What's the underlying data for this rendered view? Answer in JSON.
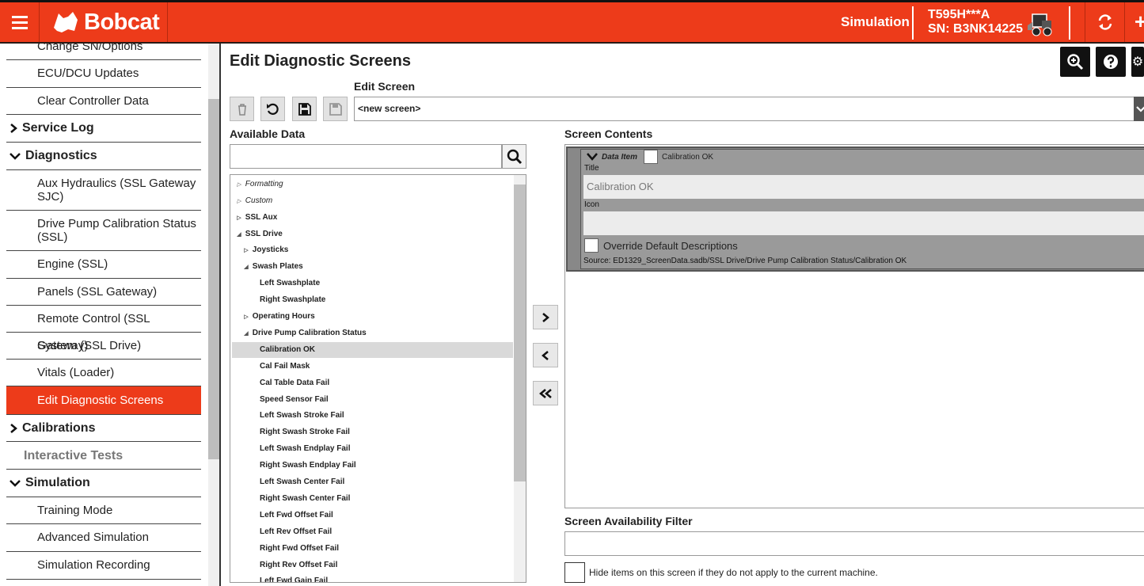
{
  "header": {
    "brand": "Bobcat",
    "mode_label": "Simulation",
    "model": "T595H***A",
    "serial": "SN: B3NK14225",
    "accent_color": "#ed3b1a"
  },
  "sidebar": {
    "items": [
      {
        "label": "Change SN/Options"
      },
      {
        "label": "ECU/DCU Updates"
      },
      {
        "label": "Clear Controller Data"
      },
      {
        "label": "Service Log"
      },
      {
        "label": "Diagnostics"
      },
      {
        "label": "Aux Hydraulics (SSL Gateway SJC)"
      },
      {
        "label": "Drive Pump Calibration Status (SSL)"
      },
      {
        "label": "Engine (SSL)"
      },
      {
        "label": "Panels (SSL Gateway)"
      },
      {
        "label": "Remote Control (SSL Gateway)"
      },
      {
        "label": "System (SSL Drive)"
      },
      {
        "label": "Vitals (Loader)"
      },
      {
        "label": "Edit Diagnostic Screens"
      },
      {
        "label": "Calibrations"
      },
      {
        "label": "Interactive Tests"
      },
      {
        "label": "Simulation"
      },
      {
        "label": "Training Mode"
      },
      {
        "label": "Advanced Simulation"
      },
      {
        "label": "Simulation Recording"
      }
    ]
  },
  "main": {
    "title": "Edit Diagnostic Screens",
    "edit_screen_label": "Edit Screen",
    "edit_screen_value": "<new screen>",
    "available_data_label": "Available Data",
    "screen_contents_label": "Screen Contents",
    "screen_filter_label": "Screen Availability Filter",
    "hide_items_text": "Hide items on this screen if they do not apply to the current machine."
  },
  "tree": [
    {
      "label": "Formatting"
    },
    {
      "label": "Custom"
    },
    {
      "label": "SSL Aux"
    },
    {
      "label": "SSL Drive"
    },
    {
      "label": "Joysticks"
    },
    {
      "label": "Swash Plates"
    },
    {
      "label": "Left Swashplate"
    },
    {
      "label": "Right Swashplate"
    },
    {
      "label": "Operating Hours"
    },
    {
      "label": "Drive Pump Calibration Status"
    },
    {
      "label": "Calibration OK"
    },
    {
      "label": "Cal Fail Mask"
    },
    {
      "label": "Cal Table Data Fail"
    },
    {
      "label": "Speed Sensor Fail"
    },
    {
      "label": "Left Swash Stroke Fail"
    },
    {
      "label": "Right Swash Stroke Fail"
    },
    {
      "label": "Left Swash Endplay Fail"
    },
    {
      "label": "Right Swash Endplay Fail"
    },
    {
      "label": "Left Swash Center Fail"
    },
    {
      "label": "Right Swash Center Fail"
    },
    {
      "label": "Left Fwd Offset Fail"
    },
    {
      "label": "Left Rev Offset Fail"
    },
    {
      "label": "Right Fwd Offset Fail"
    },
    {
      "label": "Right Rev Offset Fail"
    },
    {
      "label": "Left Fwd Gain Fail"
    }
  ],
  "data_item": {
    "header": "Data Item",
    "name": "Calibration OK",
    "title_label": "Title",
    "title_value": "Calibration OK",
    "icon_label": "Icon",
    "override_label": "Override Default Descriptions",
    "source": "Source: ED1329_ScreenData.sadb/SSL Drive/Drive Pump Calibration Status/Calibration OK"
  }
}
